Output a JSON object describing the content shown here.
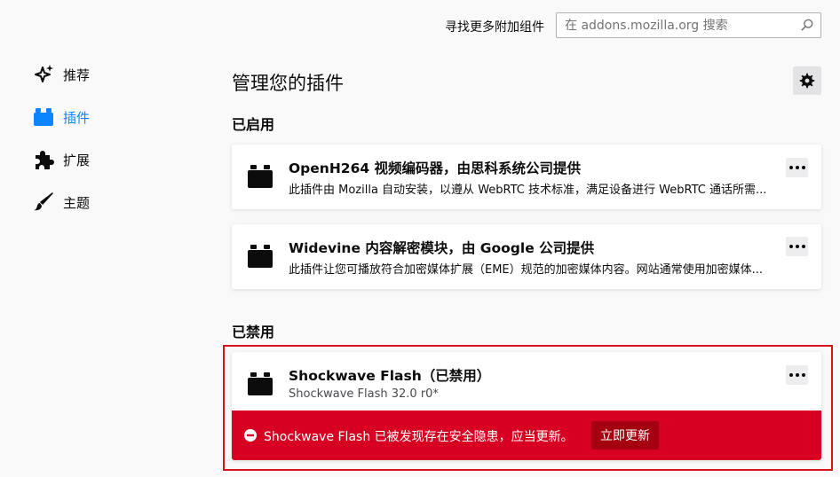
{
  "search": {
    "find_more_label": "寻找更多附加组件",
    "placeholder": "在 addons.mozilla.org 搜索"
  },
  "sidebar": {
    "items": [
      {
        "label": "推荐",
        "icon": "sparkle-icon",
        "selected": false
      },
      {
        "label": "插件",
        "icon": "plugin-icon",
        "selected": true
      },
      {
        "label": "扩展",
        "icon": "puzzle-icon",
        "selected": false
      },
      {
        "label": "主题",
        "icon": "brush-icon",
        "selected": false
      }
    ]
  },
  "main": {
    "title": "管理您的插件",
    "enabled_section": "已启用",
    "disabled_section": "已禁用",
    "plugins_enabled": [
      {
        "name": "OpenH264 视频编码器，由思科系统公司提供",
        "description": "此插件由 Mozilla 自动安装，以遵从 WebRTC 技术标准，满足设备进行 WebRTC 通话所需..."
      },
      {
        "name": "Widevine 内容解密模块，由 Google 公司提供",
        "description": "此插件让您可播放符合加密媒体扩展（EME）规范的加密媒体内容。网站通常使用加密媒体..."
      }
    ],
    "plugins_disabled": [
      {
        "name": "Shockwave Flash（已禁用）",
        "version": "Shockwave Flash 32.0 r0*",
        "warning": "Shockwave Flash 已被发现存在安全隐患，应当更新。",
        "update_label": "立即更新"
      }
    ]
  },
  "colors": {
    "accent": "#0a84ff",
    "warning_bg": "#d70022",
    "update_button_bg": "#a4000f",
    "highlight_border": "#d7131b"
  }
}
